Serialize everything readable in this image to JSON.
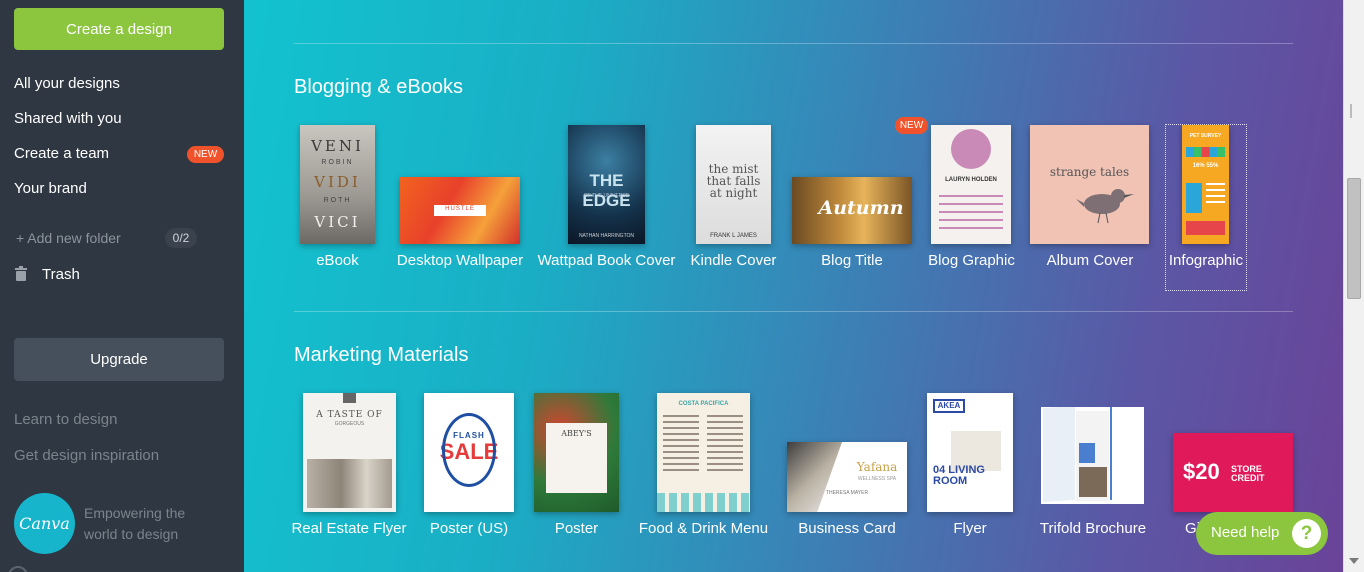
{
  "sidebar": {
    "create_label": "Create a design",
    "nav": [
      "All your designs",
      "Shared with you",
      "Create a team",
      "Your brand"
    ],
    "new_badge": "NEW",
    "add_folder": "+ Add new folder",
    "folder_count": "0/2",
    "trash": "Trash",
    "upgrade": "Upgrade",
    "learn": "Learn to design",
    "inspiration": "Get design inspiration",
    "logo_text": "Canva",
    "tagline": "Empowering the world to design"
  },
  "sections": {
    "blogging": {
      "title": "Blogging & eBooks",
      "new_badge": "NEW",
      "items": [
        "eBook",
        "Desktop Wallpaper",
        "Wattpad Book Cover",
        "Kindle Cover",
        "Blog Title",
        "Blog Graphic",
        "Album Cover",
        "Infographic"
      ]
    },
    "marketing": {
      "title": "Marketing Materials",
      "items": [
        "Real Estate Flyer",
        "Poster (US)",
        "Poster",
        "Food & Drink Menu",
        "Business Card",
        "Flyer",
        "Trifold Brochure",
        "Gi"
      ]
    }
  },
  "thumb_text": {
    "ebook_lines": [
      "VENI",
      "ROBIN",
      "VIDI",
      "ROTH",
      "VICI"
    ],
    "wallpaper": "HUSTLE",
    "wattpad_title": "THE EDGE",
    "wattpad_sub": "OF THE UNIVERSE",
    "wattpad_author": "NATHAN HARRINGTON",
    "kindle_title": "the mist that falls at night",
    "kindle_author": "FRANK L JAMES",
    "blogtitle": "Autumn",
    "bloggraphic_name": "LAURYN HOLDEN",
    "album": "strange tales",
    "infographic_title": "PET SURVEY",
    "infographic_stats": "16%  55%",
    "realestate_title": "A TASTE OF",
    "realestate_sub": "GORGEOUS",
    "poster_us_1": "FLASH",
    "poster_us_2": "SALE",
    "poster_name": "ABEY'S",
    "menu_title": "COSTA PACIFICA",
    "bizcard_name": "Yafana",
    "bizcard_sub": "WELLNESS SPA",
    "bizcard_person": "THERESA MAYER",
    "flyer_top": "AKEA",
    "flyer_big": "04 LIVING ROOM",
    "gift_amount": "$20",
    "gift_text": "STORE CREDIT"
  },
  "help": {
    "label": "Need help",
    "icon": "?"
  },
  "colors": {
    "accent": "#8cc63f",
    "badge": "#f0532c",
    "sidebar": "#2f3742"
  }
}
